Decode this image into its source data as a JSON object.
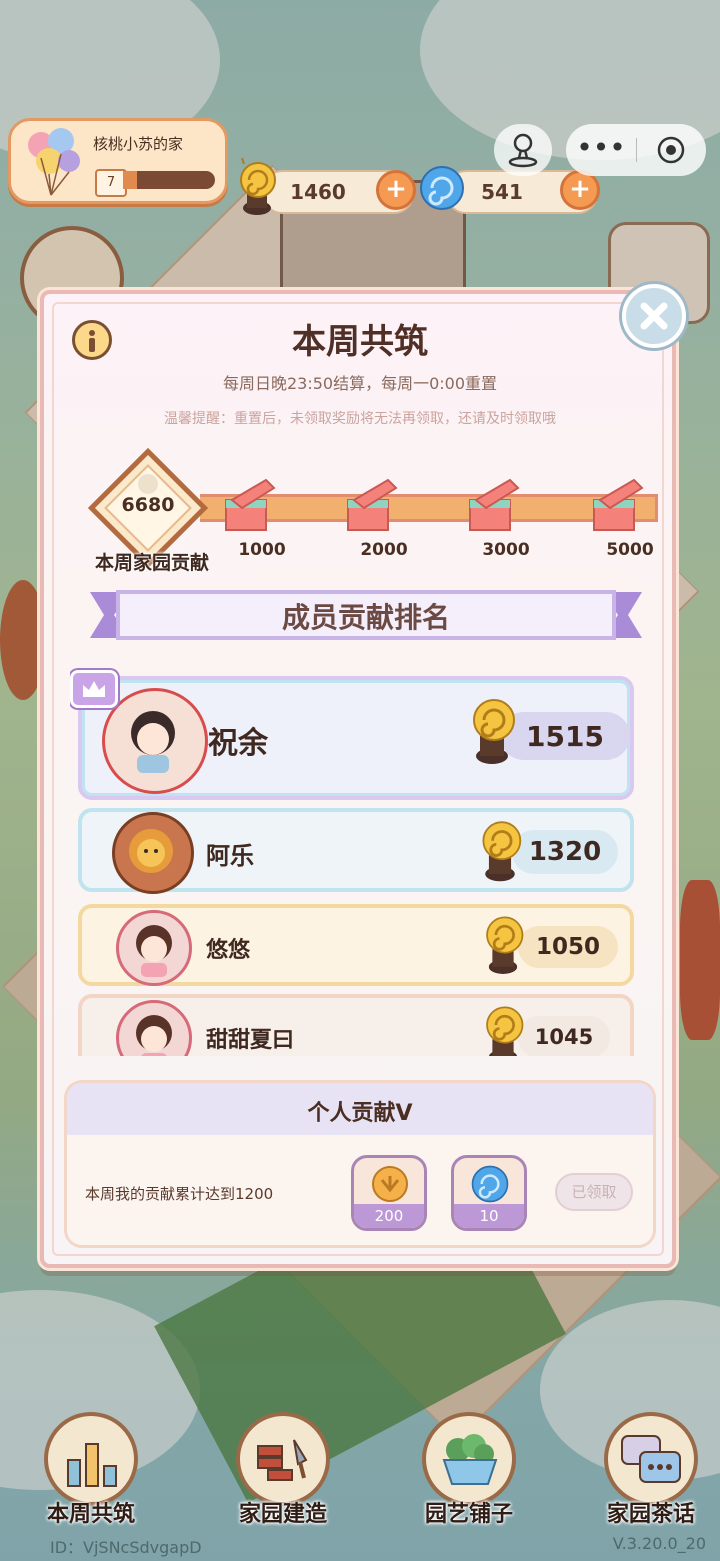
{
  "home": {
    "title": "核桃小苏的家",
    "level": "7",
    "progress": 0.15
  },
  "resources": {
    "snail_coins": "1460",
    "blue_orbs": "541"
  },
  "modal": {
    "title": "本周共筑",
    "subtitle": "每周日晚23:50结算，每周一0:00重置",
    "tip": "温馨提醒：重置后，未领取奖励将无法再领取，还请及时领取哦",
    "contribution_value": "6680",
    "contribution_label": "本周家园贡献",
    "milestones": [
      "1000",
      "2000",
      "3000",
      "5000"
    ],
    "ranking_title": "成员贡献排名",
    "members": [
      {
        "name": "祝余",
        "score": "1515"
      },
      {
        "name": "阿乐",
        "score": "1320"
      },
      {
        "name": "悠悠",
        "score": "1050"
      },
      {
        "name": "甜甜夏曰",
        "score": "1045"
      }
    ],
    "personal": {
      "title": "个人贡献Ⅴ",
      "description": "本周我的贡献累计达到1200",
      "rewards": [
        {
          "icon": "gold-coin-icon",
          "count": "200"
        },
        {
          "icon": "blue-orb-icon",
          "count": "10"
        }
      ],
      "claim_label": "已领取"
    }
  },
  "nav": [
    "本周共筑",
    "家园建造",
    "园艺铺子",
    "家园茶话"
  ],
  "footer": {
    "id": "ID：VjSNcSdvgapD",
    "version": "V.3.20.0_20"
  },
  "colors": {
    "accent": "#f59a52",
    "modal_border": "#e9b9b6",
    "ribbon": "#c8b4e6"
  }
}
